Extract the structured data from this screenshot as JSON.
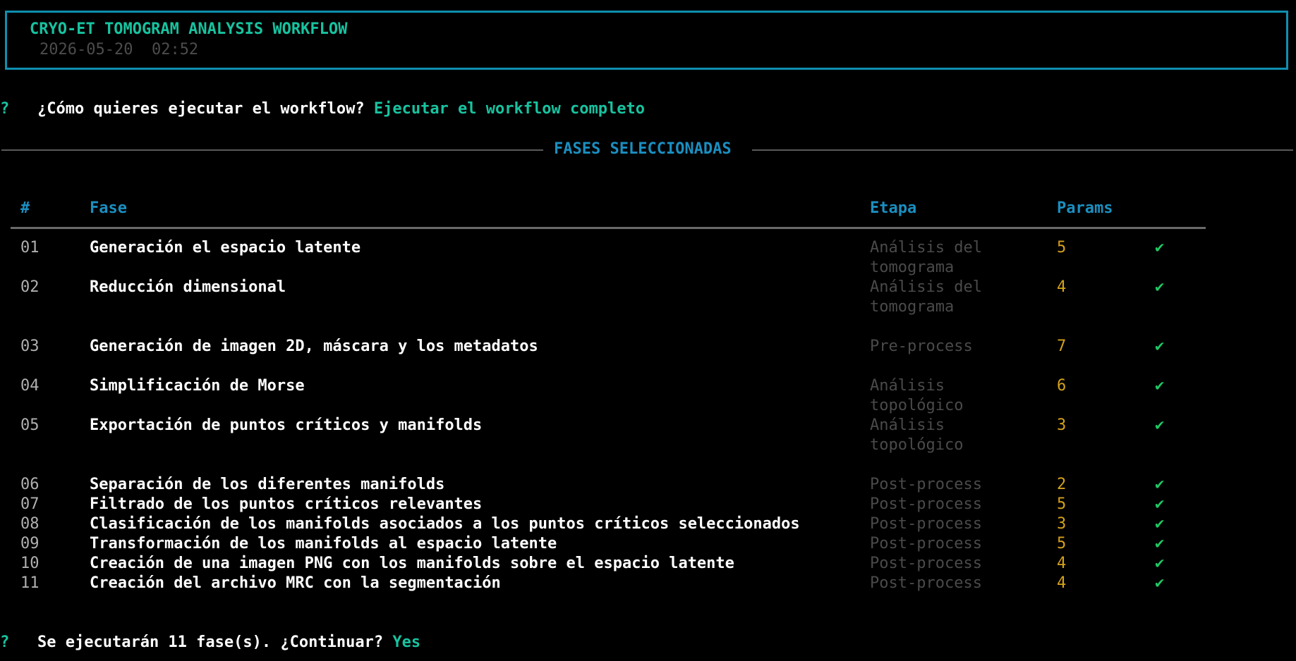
{
  "header": {
    "title": "CRYO-ET TOMOGRAM ANALYSIS WORKFLOW",
    "date": "2026-05-20",
    "time": "02:52"
  },
  "prompt1": {
    "mark": "?",
    "question": "¿Cómo quieres ejecutar el workflow?",
    "answer": "Ejecutar el workflow completo"
  },
  "section": {
    "title": "FASES SELECCIONADAS"
  },
  "table": {
    "headers": {
      "num": "#",
      "fase": "Fase",
      "etapa": "Etapa",
      "params": "Params"
    },
    "rows": [
      {
        "num": "01",
        "fase": "Generación el espacio latente",
        "etapa": "Análisis del\ntomograma",
        "params": "5",
        "status": "✔"
      },
      {
        "num": "02",
        "fase": "Reducción dimensional",
        "etapa": "Análisis del\ntomograma",
        "params": "4",
        "status": "✔"
      },
      {
        "num": "03",
        "fase": "Generación de imagen 2D, máscara y los metadatos",
        "etapa": "Pre-process",
        "params": "7",
        "status": "✔"
      },
      {
        "num": "04",
        "fase": "Simplificación de Morse",
        "etapa": "Análisis\ntopológico",
        "params": "6",
        "status": "✔"
      },
      {
        "num": "05",
        "fase": "Exportación de puntos críticos y manifolds",
        "etapa": "Análisis\ntopológico",
        "params": "3",
        "status": "✔"
      },
      {
        "num": "06",
        "fase": "Separación de los diferentes manifolds",
        "etapa": "Post-process",
        "params": "2",
        "status": "✔"
      },
      {
        "num": "07",
        "fase": "Filtrado de los puntos críticos relevantes",
        "etapa": "Post-process",
        "params": "5",
        "status": "✔"
      },
      {
        "num": "08",
        "fase": "Clasificación de los manifolds asociados a los puntos críticos seleccionados",
        "etapa": "Post-process",
        "params": "3",
        "status": "✔"
      },
      {
        "num": "09",
        "fase": "Transformación de los manifolds al espacio latente",
        "etapa": "Post-process",
        "params": "5",
        "status": "✔"
      },
      {
        "num": "10",
        "fase": "Creación de una imagen PNG con los manifolds sobre el espacio latente",
        "etapa": "Post-process",
        "params": "4",
        "status": "✔"
      },
      {
        "num": "11",
        "fase": "Creación del archivo MRC con la segmentación",
        "etapa": "Post-process",
        "params": "4",
        "status": "✔"
      }
    ]
  },
  "prompt2": {
    "mark": "?",
    "question": "Se ejecutarán 11 fase(s). ¿Continuar?",
    "answer": "Yes"
  },
  "colors": {
    "accent_teal": "#17c3a0",
    "accent_blue": "#1a8fc0",
    "box_border": "#0f8fb0",
    "params_yellow": "#d4a21a",
    "check_green": "#1ec864",
    "dim_gray": "#4a4a4a"
  }
}
